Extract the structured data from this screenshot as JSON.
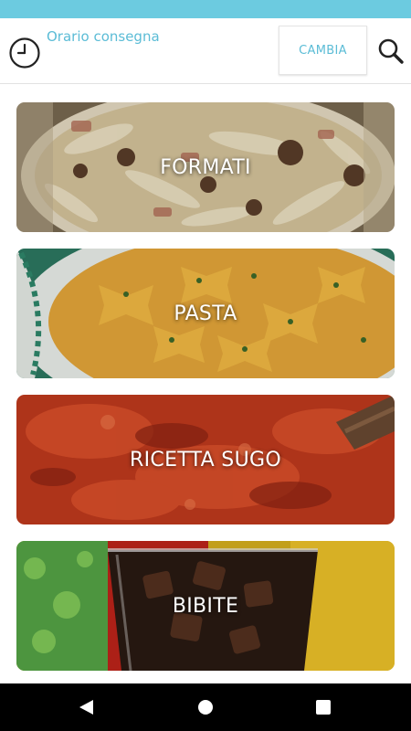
{
  "header": {
    "delivery_label": "Orario consegna",
    "change_label": "CAMBIA",
    "clock_icon": "clock-icon",
    "search_icon": "search-icon"
  },
  "categories": [
    {
      "label": "FORMATI",
      "image": "pasta-dish-photo"
    },
    {
      "label": "PASTA",
      "image": "farfalle-photo"
    },
    {
      "label": "RICETTA SUGO",
      "image": "tomato-sauce-photo"
    },
    {
      "label": "BIBITE",
      "image": "drinks-photo"
    }
  ],
  "colors": {
    "status_bar": "#6ccbe0",
    "accent": "#5bbcd6",
    "nav_bar": "#000000"
  },
  "nav": {
    "back_icon": "back-triangle-icon",
    "home_icon": "home-circle-icon",
    "recent_icon": "recent-apps-icon"
  }
}
